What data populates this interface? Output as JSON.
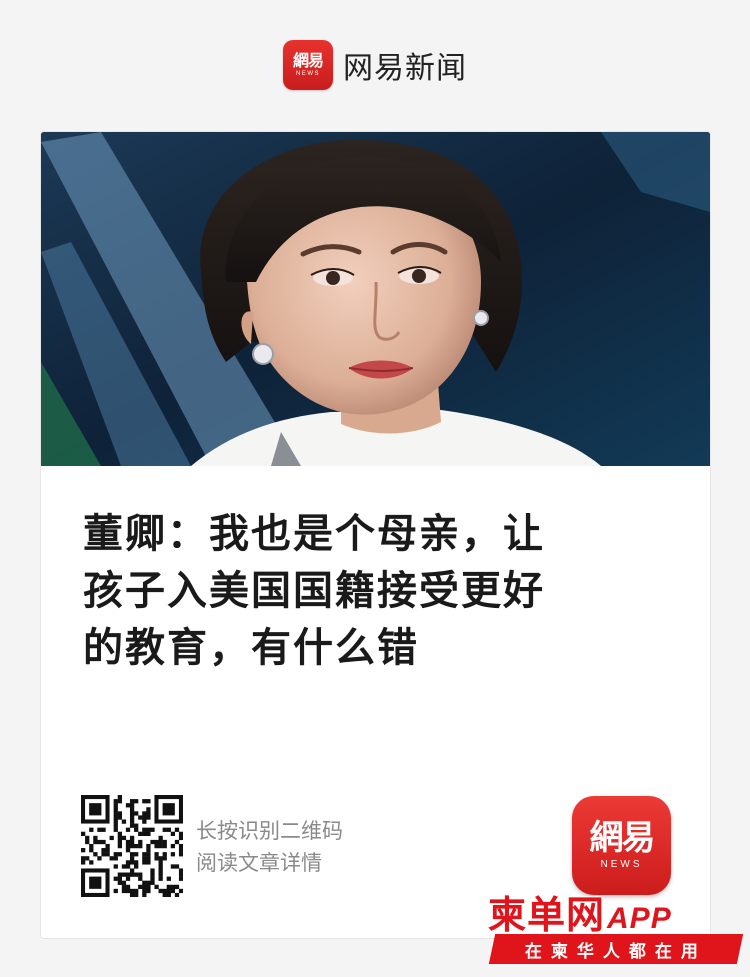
{
  "header": {
    "logo_text": "網易",
    "logo_subtext": "NEWS",
    "brand_name": "网易新闻"
  },
  "article": {
    "image_icon": "news-photo",
    "headline_lines": [
      "董卿：我也是个母亲，让",
      "孩子入美国国籍接受更好",
      "的教育，有什么错"
    ]
  },
  "share": {
    "qr_icon": "qr-code",
    "instruction_lines": [
      "长按识别二维码",
      "阅读文章详情"
    ],
    "app_icon_text": "網易",
    "app_icon_subtext": "NEWS"
  },
  "watermark": {
    "main": "柬单网",
    "app": "APP",
    "tagline": "在柬华人都在用"
  },
  "colors": {
    "page_background": "#f4f4f4",
    "card_background": "#ffffff",
    "brand_red": "#d8201f",
    "watermark_red": "#e0151b",
    "headline_text": "#1a1a1a",
    "instruction_text": "#8a8a8a"
  }
}
